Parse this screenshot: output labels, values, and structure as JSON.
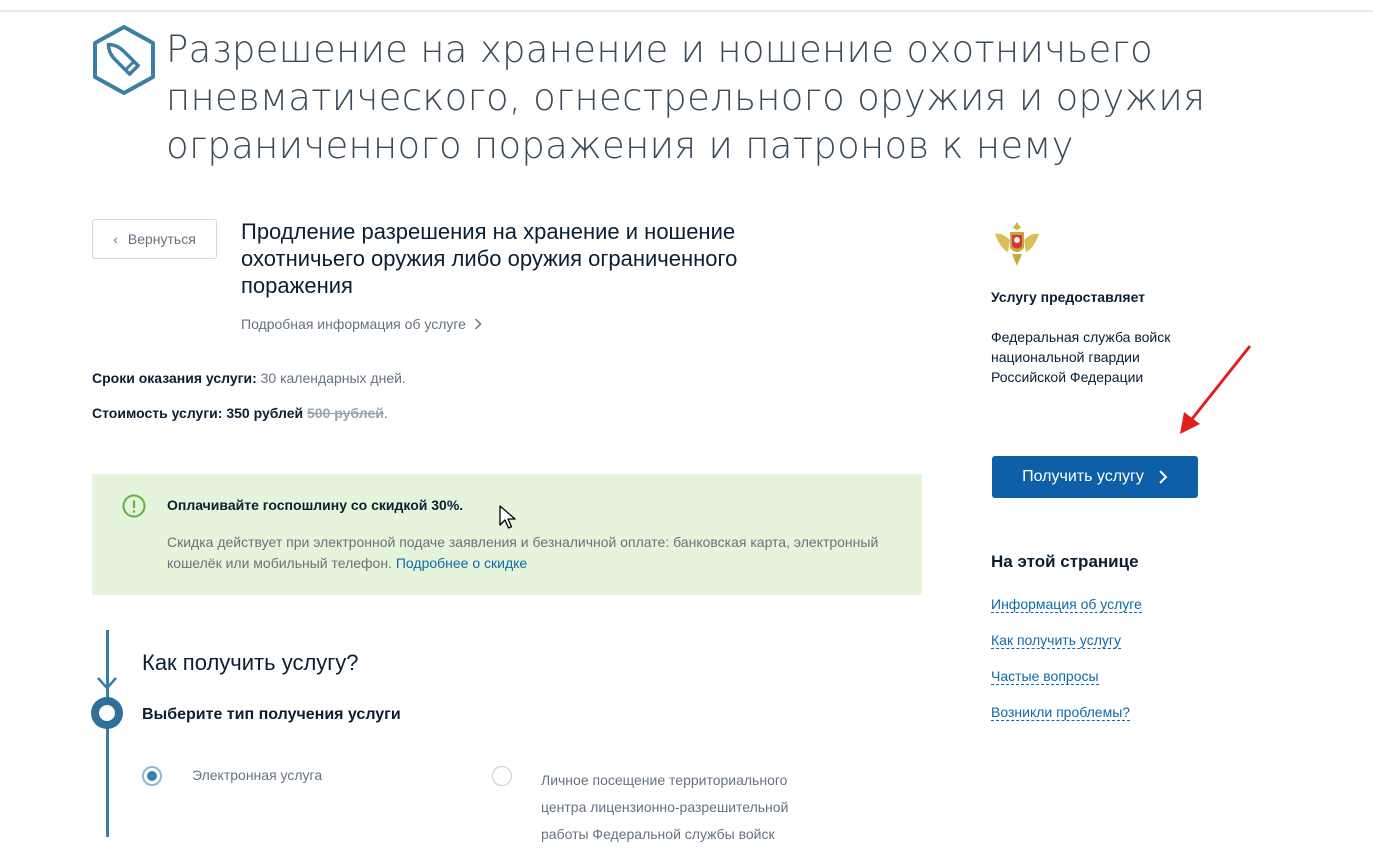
{
  "header": {
    "title": "Разрешение на хранение и ношение охотничьего пневматического, огнестрельного оружия и оружия ограниченного поражения и патронов к нему",
    "icon": "bullet-icon"
  },
  "navigation": {
    "back_label": "Вернуться"
  },
  "service": {
    "title": "Продление разрешения на хранение и ношение охотничьего оружия либо оружия ограниченного поражения",
    "details_link": "Подробная информация об услуге",
    "term_label": "Сроки оказания услуги:",
    "term_value": "30 календарных дней.",
    "price_label": "Стоимость услуги:",
    "price_value": "350 рублей",
    "price_old": "500 рублей",
    "price_end": "."
  },
  "promo": {
    "heading": "Оплачивайте госпошлину со скидкой 30%.",
    "body": "Скидка действует при электронной подаче заявления и безналичной оплате: банковская карта, электронный кошелёк или мобильный телефон.",
    "link": "Подробнее о скидке",
    "accent_color": "#e6f4dc"
  },
  "how_to": {
    "title": "Как получить услугу?",
    "step_title": "Выберите тип получения услуги",
    "options": [
      {
        "label": "Электронная услуга",
        "selected": true
      },
      {
        "label": "Личное посещение территориального центра лицензионно-разрешительной работы Федеральной службы войск",
        "selected": false
      }
    ]
  },
  "sidebar": {
    "provider_label": "Услугу предоставляет",
    "provider_name": "Федеральная служба войск национальной гвардии Российской Федерации",
    "get_service_button": "Получить услугу",
    "on_page_title": "На этой странице",
    "toc": [
      "Информация об услуге",
      "Как получить услугу",
      "Частые вопросы",
      "Возникли проблемы?"
    ]
  },
  "colors": {
    "primary_button": "#0d5fa8",
    "link": "#0d6aa8",
    "annotation_arrow": "#e02020"
  }
}
